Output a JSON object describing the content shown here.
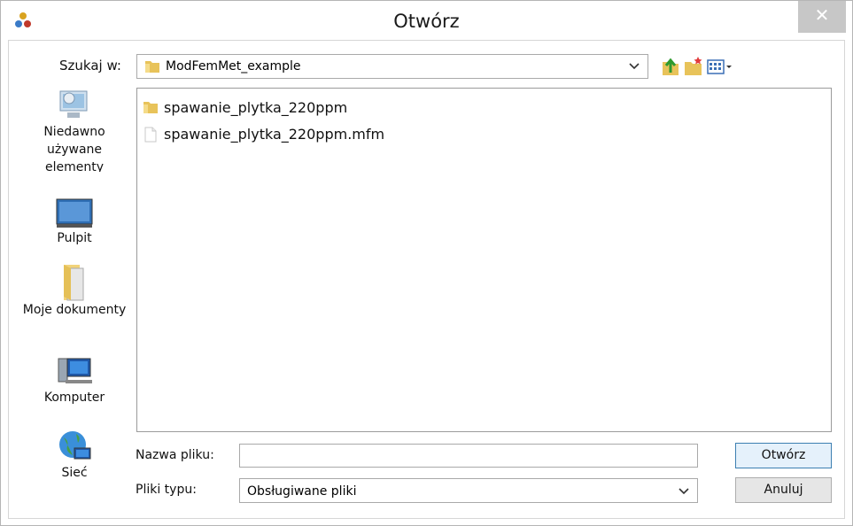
{
  "window": {
    "title": "Otwórz",
    "close_glyph": "✕",
    "accent_close": "#c7c7c7"
  },
  "lookin": {
    "label": "Szukaj w:",
    "value": "ModFemMet_example",
    "dropdown_icon": "chevron-down-icon"
  },
  "toolbar": {
    "icons": [
      "up-folder-icon",
      "new-folder-icon",
      "view-menu-icon"
    ]
  },
  "places": [
    {
      "label": "Niedawno używane elementy",
      "icon": "recent-items-icon"
    },
    {
      "label": "Pulpit",
      "icon": "desktop-icon"
    },
    {
      "label": "Moje dokumenty",
      "icon": "documents-icon"
    },
    {
      "label": "Komputer",
      "icon": "computer-icon"
    },
    {
      "label": "Sieć",
      "icon": "network-icon"
    }
  ],
  "files": [
    {
      "name": "spawanie_plytka_220ppm",
      "type": "folder"
    },
    {
      "name": "spawanie_plytka_220ppm.mfm",
      "type": "file"
    }
  ],
  "filename": {
    "label": "Nazwa pliku:",
    "value": ""
  },
  "filetype": {
    "label": "Pliki typu:",
    "value": "Obsługiwane pliki"
  },
  "buttons": {
    "open": "Otwórz",
    "cancel": "Anuluj"
  }
}
